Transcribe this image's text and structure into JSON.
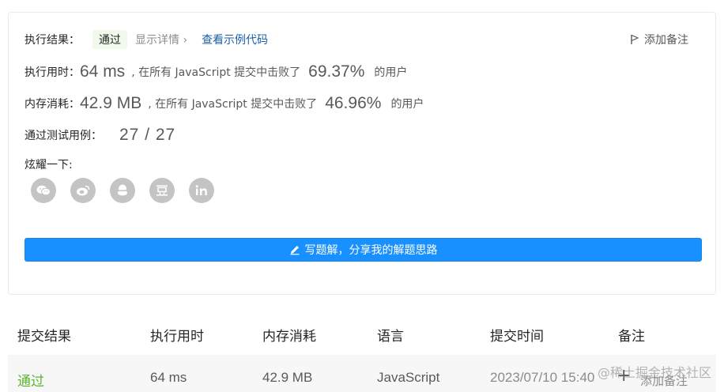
{
  "result": {
    "label": "执行结果：",
    "status": "通过",
    "details": "显示详情 ›",
    "sample_link": "查看示例代码",
    "add_note": "添加备注"
  },
  "runtime": {
    "label": "执行用时：",
    "value": "64 ms",
    "mid": ", 在所有 JavaScript 提交中击败了",
    "percent": "69.37%",
    "suffix": "的用户"
  },
  "memory": {
    "label": "内存消耗：",
    "value": "42.9 MB",
    "mid": ", 在所有 JavaScript 提交中击败了",
    "percent": "46.96%",
    "suffix": "的用户"
  },
  "tests": {
    "label": "通过测试用例：",
    "value": "27 / 27"
  },
  "share": {
    "label": "炫耀一下:",
    "icons": [
      "wechat-icon",
      "weibo-icon",
      "qq-icon",
      "douban-icon",
      "linkedin-icon"
    ]
  },
  "write_solution": {
    "label": "写题解，分享我的解题思路",
    "icon": "pencil-icon"
  },
  "table": {
    "headers": [
      "提交结果",
      "执行用时",
      "内存消耗",
      "语言",
      "提交时间",
      "备注"
    ],
    "row": {
      "status": "通过",
      "runtime": "64 ms",
      "memory": "42.9 MB",
      "language": "JavaScript",
      "time": "2023/07/10 15:40",
      "note": "添加备注"
    }
  },
  "watermark": "@稀土掘金技术社区",
  "colors": {
    "accent": "#1890ff",
    "pass": "#5bb52e",
    "link": "#1a5fa8"
  }
}
